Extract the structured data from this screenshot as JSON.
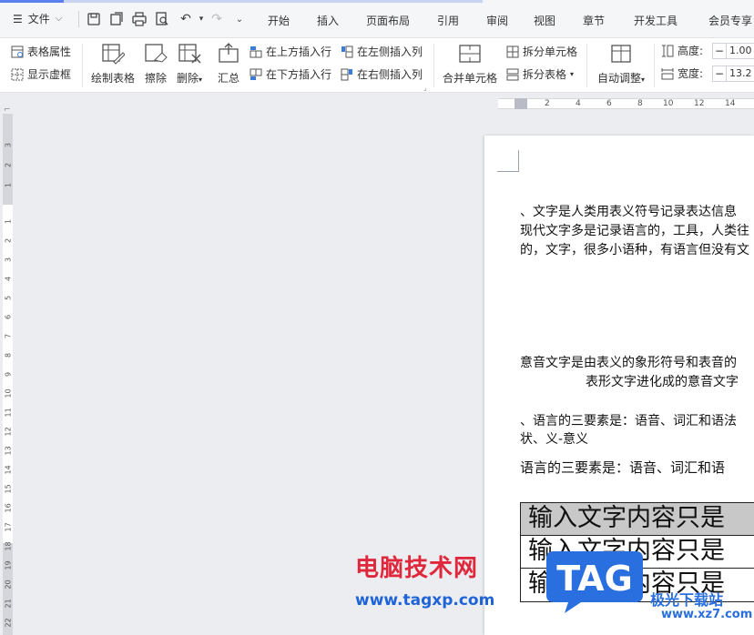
{
  "menu": {
    "file_label": "文件",
    "tabs": [
      "开始",
      "插入",
      "页面布局",
      "引用",
      "审阅",
      "视图",
      "章节",
      "开发工具",
      "会员专享"
    ]
  },
  "ribbon": {
    "table_props": "表格属性",
    "show_gridlines": "显示虚框",
    "draw_table": "绘制表格",
    "erase": "擦除",
    "delete": "删除",
    "summary": "汇总",
    "insert_row_above": "在上方插入行",
    "insert_row_below": "在下方插入行",
    "insert_col_left": "在左侧插入列",
    "insert_col_right": "在右侧插入列",
    "merge_cells": "合并单元格",
    "split_cells": "拆分单元格",
    "split_table": "拆分表格",
    "auto_fit": "自动调整",
    "height_label": "高度:",
    "height_value": "1.00",
    "width_label": "宽度:",
    "width_value": "13.2",
    "minus": "−"
  },
  "ruler": {
    "h_ticks": [
      "2",
      "4",
      "6",
      "8",
      "10",
      "12",
      "14"
    ],
    "v_ticks_top": [
      "3",
      "2",
      "1"
    ],
    "v_ticks": [
      "1",
      "2",
      "3",
      "4",
      "5",
      "6",
      "7",
      "8",
      "9",
      "10",
      "11",
      "12",
      "13",
      "14",
      "15",
      "16",
      "17",
      "18",
      "19",
      "20",
      "21",
      "22"
    ],
    "corner": "⌐"
  },
  "document": {
    "p1_line1": "、文字是人类用表义符号记录表达信息",
    "p1_line2": "现代文字多是记录语言的，工具，人类往",
    "p1_line3": "的，文字，很多小语种，有语言但没有文",
    "p2_line1": "意音文字是由表义的象形符号和表音的",
    "p2_line2": "表形文字进化成的意音文字",
    "p3_line1": "、语言的三要素是：语音、词汇和语法",
    "p3_line2": "状、义-意义",
    "p4": "语言的三要素是：语音、词汇和语",
    "table_rows": [
      "输入文字内容只是",
      "输入文字内容只是",
      "输入文字内容只是"
    ]
  },
  "watermark": {
    "site_cn": "电脑技术网",
    "site_url": "www.tagxp.com",
    "tag": "TAG",
    "sub1": "极光下载站",
    "sub2": "www.xz7.com"
  }
}
